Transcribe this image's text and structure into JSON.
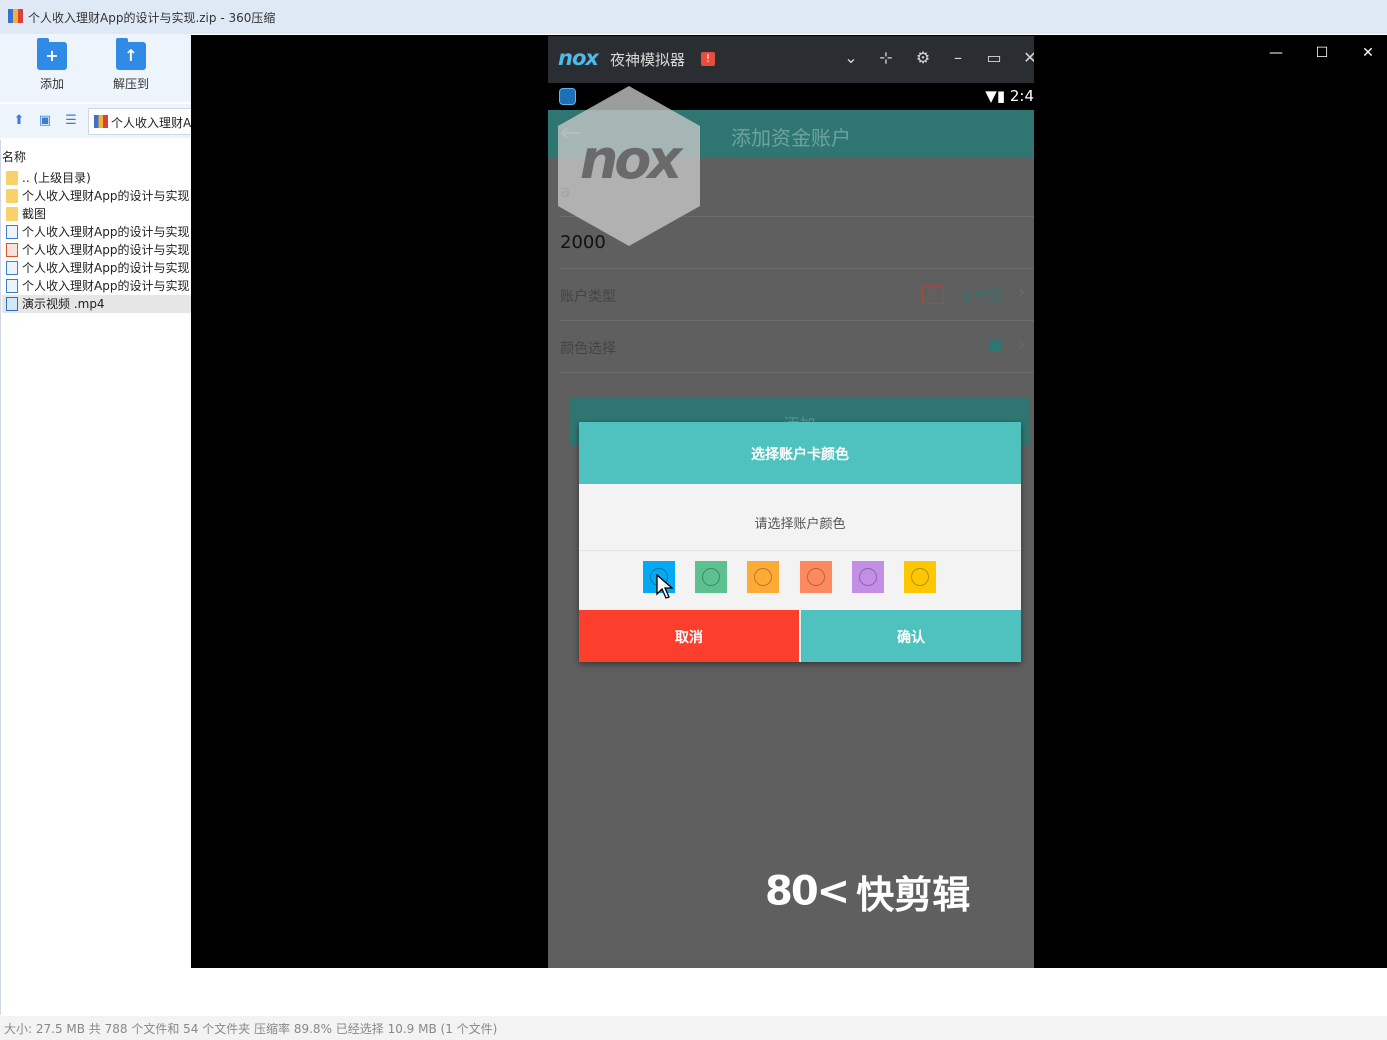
{
  "window": {
    "title": "个人收入理财App的设计与实现.zip - 360压缩"
  },
  "toolbar": {
    "add_label": "添加",
    "extract_label": "解压到"
  },
  "address": {
    "path": "个人收入理财A"
  },
  "filelist": {
    "column_name": "名称",
    "rows": [
      {
        "name": ".. (上级目录)",
        "icon": "folder-icon"
      },
      {
        "name": "个人收入理财App的设计与实现",
        "icon": "folder-icon"
      },
      {
        "name": "截图",
        "icon": "folder-icon"
      },
      {
        "name": "个人收入理财App的设计与实现",
        "icon": "doc-icon"
      },
      {
        "name": "个人收入理财App的设计与实现",
        "icon": "ppt-icon"
      },
      {
        "name": "个人收入理财App的设计与实现",
        "icon": "doc-icon"
      },
      {
        "name": "个人收入理财App的设计与实现",
        "icon": "doc-icon"
      },
      {
        "name": "演示视频 .mp4",
        "icon": "video-icon",
        "selected": true
      }
    ]
  },
  "statusbar": {
    "text": "大小: 27.5 MB 共 788 个文件和 54 个文件夹 压缩率 89.8% 已经选择 10.9 MB (1 个文件)"
  },
  "nox": {
    "logo": "nox",
    "name": "夜神模拟器",
    "warn": "!",
    "status_time": "2:4",
    "watermark": "nox"
  },
  "app": {
    "title": "添加资金账户",
    "back": "←",
    "account_name": "a",
    "amount": "2000",
    "account_type_label": "账户类型",
    "account_type_value": "支付宝",
    "color_label": "颜色选择",
    "add_button": "添加"
  },
  "dialog": {
    "title": "选择账户卡颜色",
    "message": "请选择账户颜色",
    "cancel": "取消",
    "confirm": "确认",
    "colors": [
      "#05a8f3",
      "#5cc08f",
      "#fdaa36",
      "#fd8a5e",
      "#c28ee6",
      "#fdc802"
    ]
  },
  "watermark": {
    "logo": "80<",
    "text": "快剪辑"
  },
  "colors": {
    "teal": "#4fc1be",
    "cancel_red": "#fc3e2c",
    "header_dark_teal": "#2f7672"
  }
}
